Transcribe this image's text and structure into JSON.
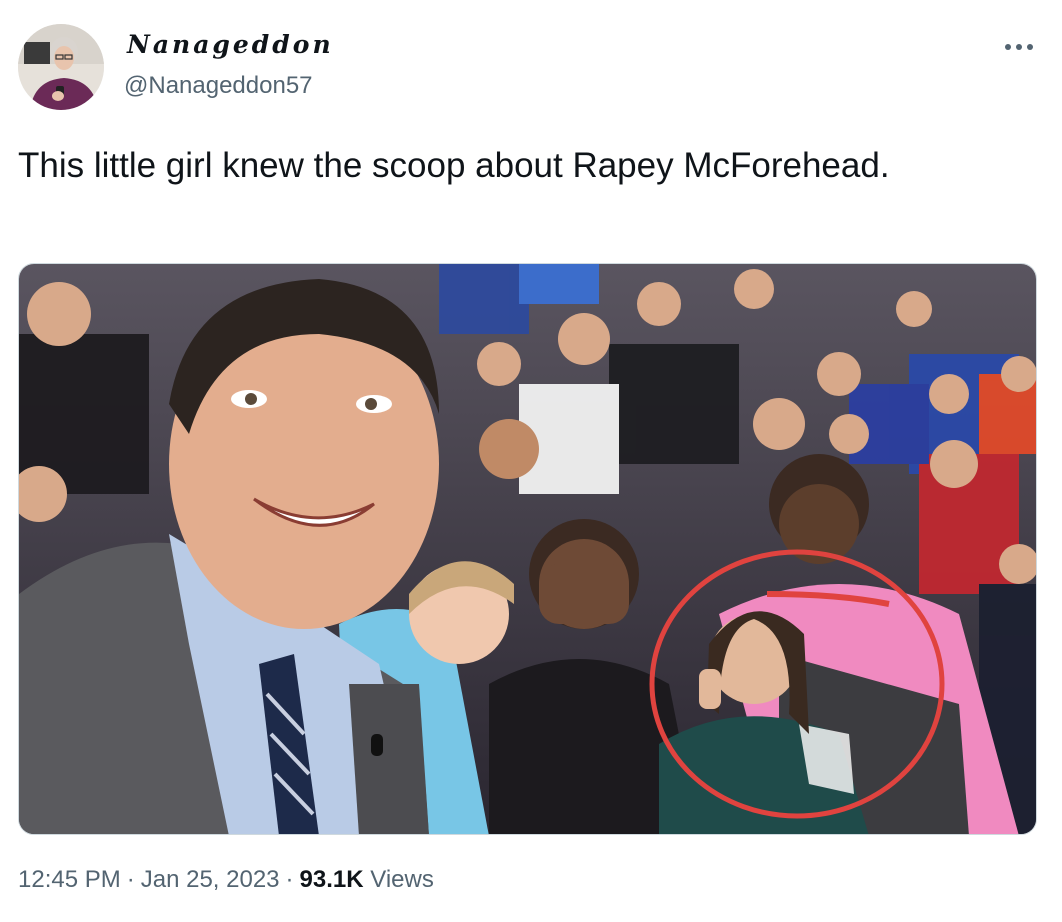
{
  "author": {
    "display_name": "Nanageddon",
    "handle": "@Nanageddon57"
  },
  "tweet": {
    "text": "This little girl knew the scoop about Rapey McForehead."
  },
  "media": {
    "annotation_color": "#e0433f"
  },
  "meta": {
    "time": "12:45 PM",
    "separator": "·",
    "date": "Jan 25, 2023",
    "views_count": "93.1K",
    "views_label": "Views"
  },
  "icons": {
    "more": "more-horizontal-icon"
  }
}
